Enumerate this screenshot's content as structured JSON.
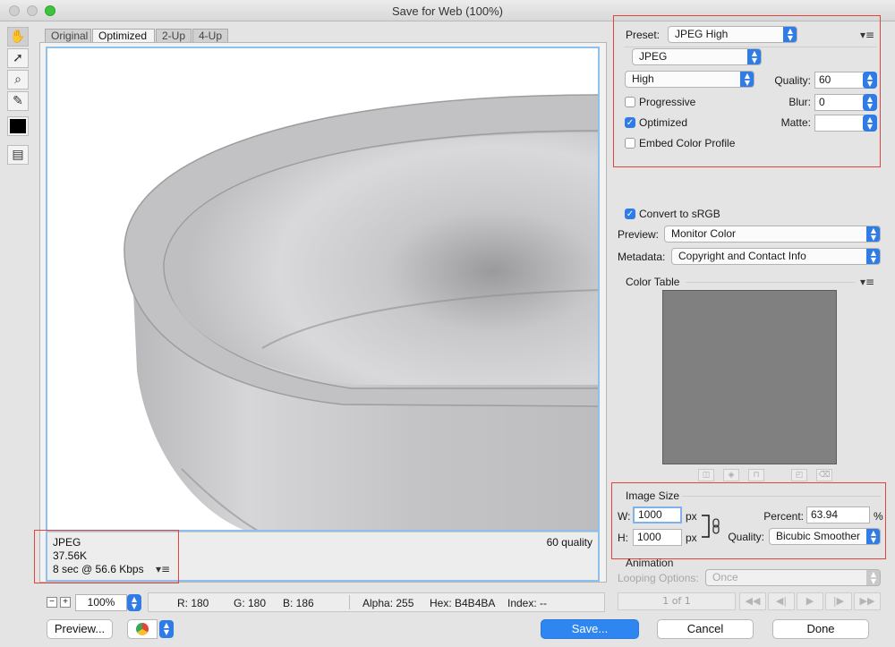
{
  "window": {
    "title": "Save for Web (100%)"
  },
  "tabs": [
    {
      "label": "Original"
    },
    {
      "label": "Optimized"
    },
    {
      "label": "2-Up"
    },
    {
      "label": "4-Up"
    }
  ],
  "preview_info": {
    "format": "JPEG",
    "size": "37.56K",
    "time": "8 sec @ 56.6 Kbps",
    "quality": "60 quality"
  },
  "settings": {
    "preset_label": "Preset:",
    "preset_value": "JPEG High",
    "format_value": "JPEG",
    "compression_value": "High",
    "quality_label": "Quality:",
    "quality_value": "60",
    "progressive_label": "Progressive",
    "blur_label": "Blur:",
    "blur_value": "0",
    "optimized_label": "Optimized",
    "matte_label": "Matte:",
    "matte_value": "",
    "embed_label": "Embed Color Profile"
  },
  "color": {
    "convert_label": "Convert to sRGB",
    "preview_label": "Preview:",
    "preview_value": "Monitor Color",
    "metadata_label": "Metadata:",
    "metadata_value": "Copyright and Contact Info",
    "color_table_label": "Color Table",
    "color_table_fill": "#808080"
  },
  "image_size": {
    "section_label": "Image Size",
    "w_label": "W:",
    "w_value": "1000",
    "h_label": "H:",
    "h_value": "1000",
    "unit": "px",
    "percent_label": "Percent:",
    "percent_value": "63.94",
    "percent_unit": "%",
    "quality_label": "Quality:",
    "quality_value": "Bicubic Smoother"
  },
  "animation": {
    "section_label": "Animation",
    "looping_label": "Looping Options:",
    "looping_value": "Once",
    "frame_counter": "1 of 1"
  },
  "status": {
    "zoom": "100%",
    "r": "R: 180",
    "g": "G: 180",
    "b": "B: 186",
    "alpha": "Alpha: 255",
    "hex": "Hex: B4B4BA",
    "index": "Index: --"
  },
  "buttons": {
    "preview": "Preview...",
    "save": "Save...",
    "cancel": "Cancel",
    "done": "Done"
  },
  "colors": {
    "accent": "#2f7ce6",
    "highlight_box": "#e0443a",
    "preview_border": "#8fc0ec"
  }
}
